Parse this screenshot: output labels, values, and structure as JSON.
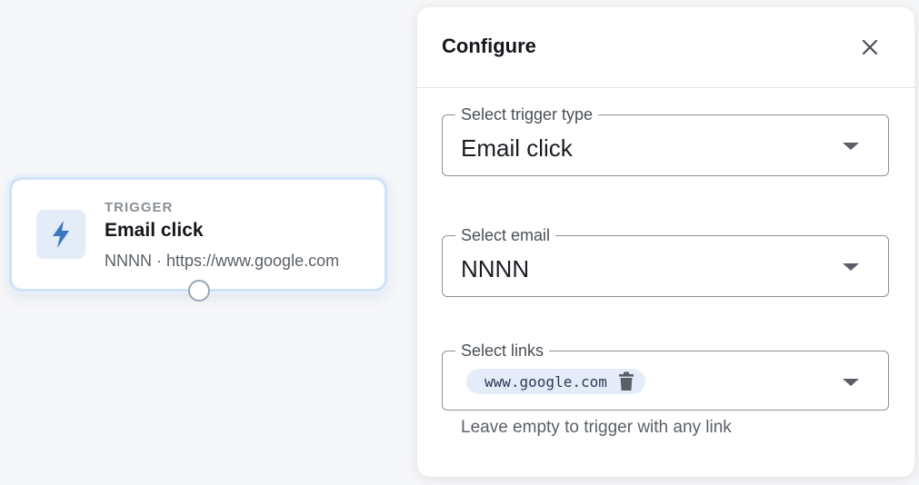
{
  "node": {
    "eyebrow": "TRIGGER",
    "title": "Email click",
    "subtitle": "NNNN · https://www.google.com",
    "icon": "lightning-bolt-icon",
    "accent": "#3a78c2"
  },
  "panel": {
    "title": "Configure",
    "close_icon": "close-icon",
    "fields": {
      "trigger_type": {
        "label": "Select trigger type",
        "value": "Email click"
      },
      "email": {
        "label": "Select email",
        "value": "NNNN"
      },
      "links": {
        "label": "Select links",
        "chips": [
          "www.google.com"
        ],
        "helper": "Leave empty to trigger with any link"
      }
    }
  }
}
